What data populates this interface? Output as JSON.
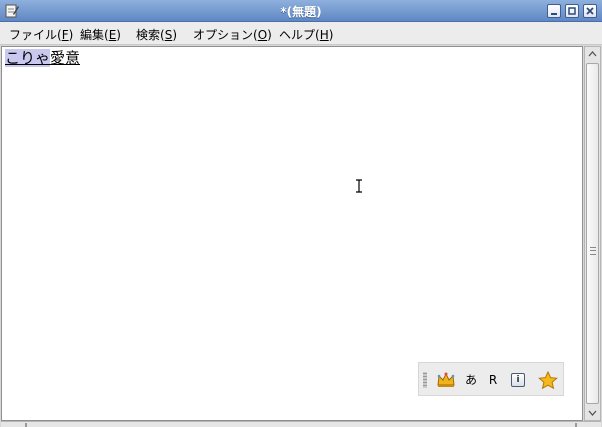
{
  "window": {
    "title": "*(無題)",
    "icon": "text-editor-icon",
    "controls": [
      "minimize-icon",
      "maximize-icon",
      "close-icon"
    ]
  },
  "menubar": {
    "items": [
      {
        "label": "ファイル(",
        "mnemonic": "F",
        "suffix": ")"
      },
      {
        "label": "編集(",
        "mnemonic": "E",
        "suffix": ")"
      },
      {
        "label": "検索(",
        "mnemonic": "S",
        "suffix": ")"
      },
      {
        "label": "オプション(",
        "mnemonic": "O",
        "suffix": ")"
      },
      {
        "label": "ヘルプ(",
        "mnemonic": "H",
        "suffix": ")"
      }
    ]
  },
  "editor": {
    "selected_text": "こりゃ",
    "preedit_text": "愛意"
  },
  "ime_toolbar": {
    "items": [
      {
        "icon": "crown-icon"
      },
      {
        "text": "あ"
      },
      {
        "text": "R"
      },
      {
        "icon": "info-icon",
        "text": "i"
      },
      {
        "icon": "star-icon"
      }
    ]
  },
  "colors": {
    "titlebar": "#6e95cf",
    "selection": "#c9c9f0",
    "editor_bg": "#ffffff"
  }
}
